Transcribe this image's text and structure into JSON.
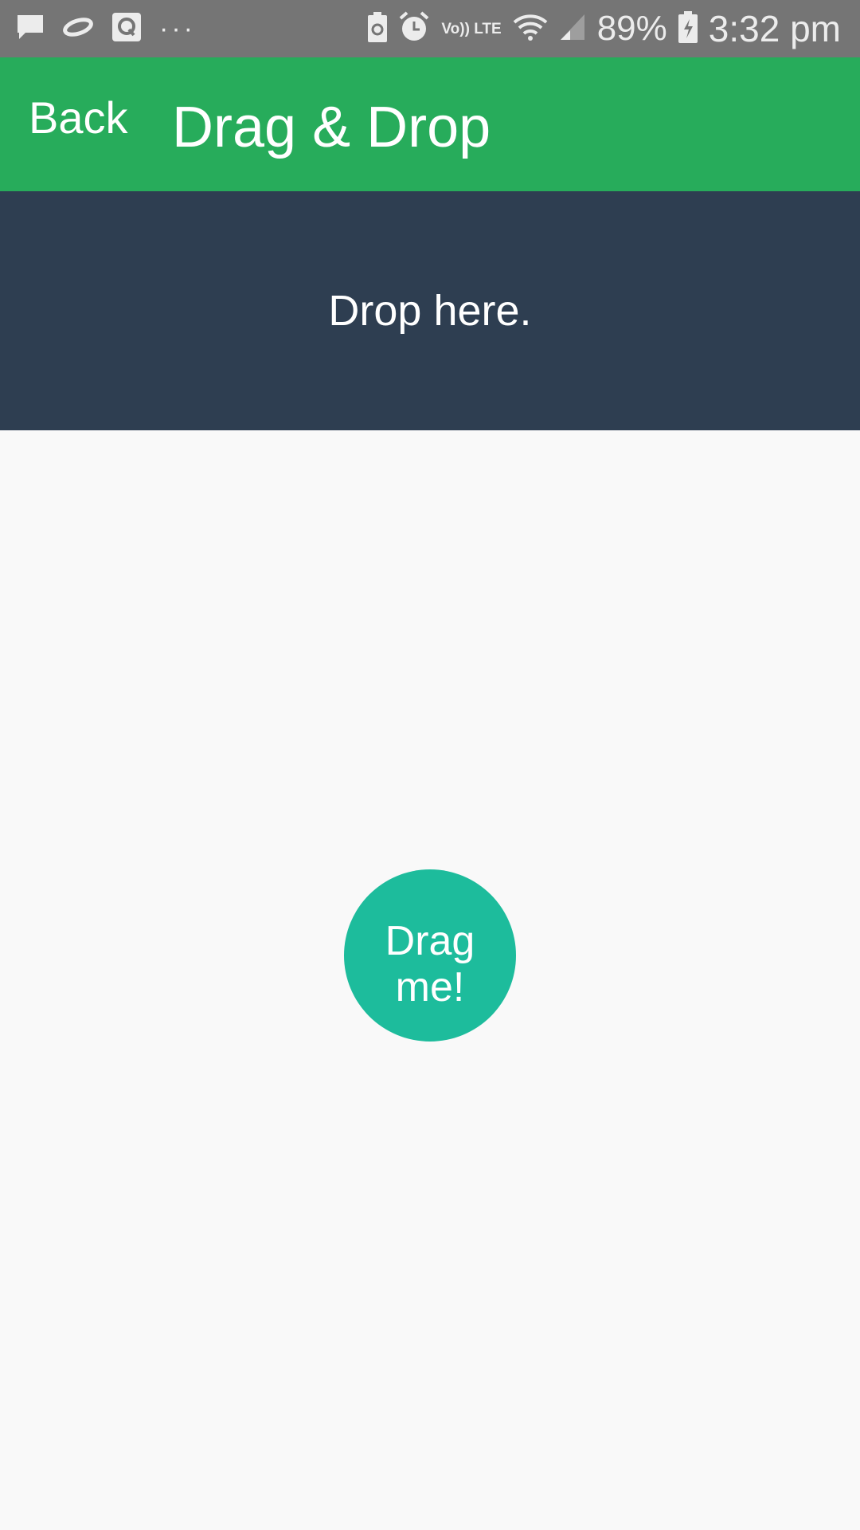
{
  "status_bar": {
    "left_icons": [
      "message-icon",
      "link-icon",
      "q-app-icon",
      "more-dots-icon"
    ],
    "right_icons": [
      "battery-saver-icon",
      "alarm-icon",
      "volte-icon",
      "wifi-icon",
      "signal-icon",
      "battery-charging-icon"
    ],
    "volte_text": "Vo)) LTE",
    "battery_percent": "89%",
    "time": "3:32 pm"
  },
  "app_bar": {
    "back_label": "Back",
    "title": "Drag & Drop"
  },
  "drop_zone": {
    "label": "Drop here."
  },
  "draggable": {
    "label": "Drag me!"
  },
  "colors": {
    "status_bar": "#757575",
    "app_bar": "#27ac5b",
    "drop_zone": "#2e3e51",
    "draggable": "#1dbc9c",
    "background": "#f9f9f9"
  }
}
